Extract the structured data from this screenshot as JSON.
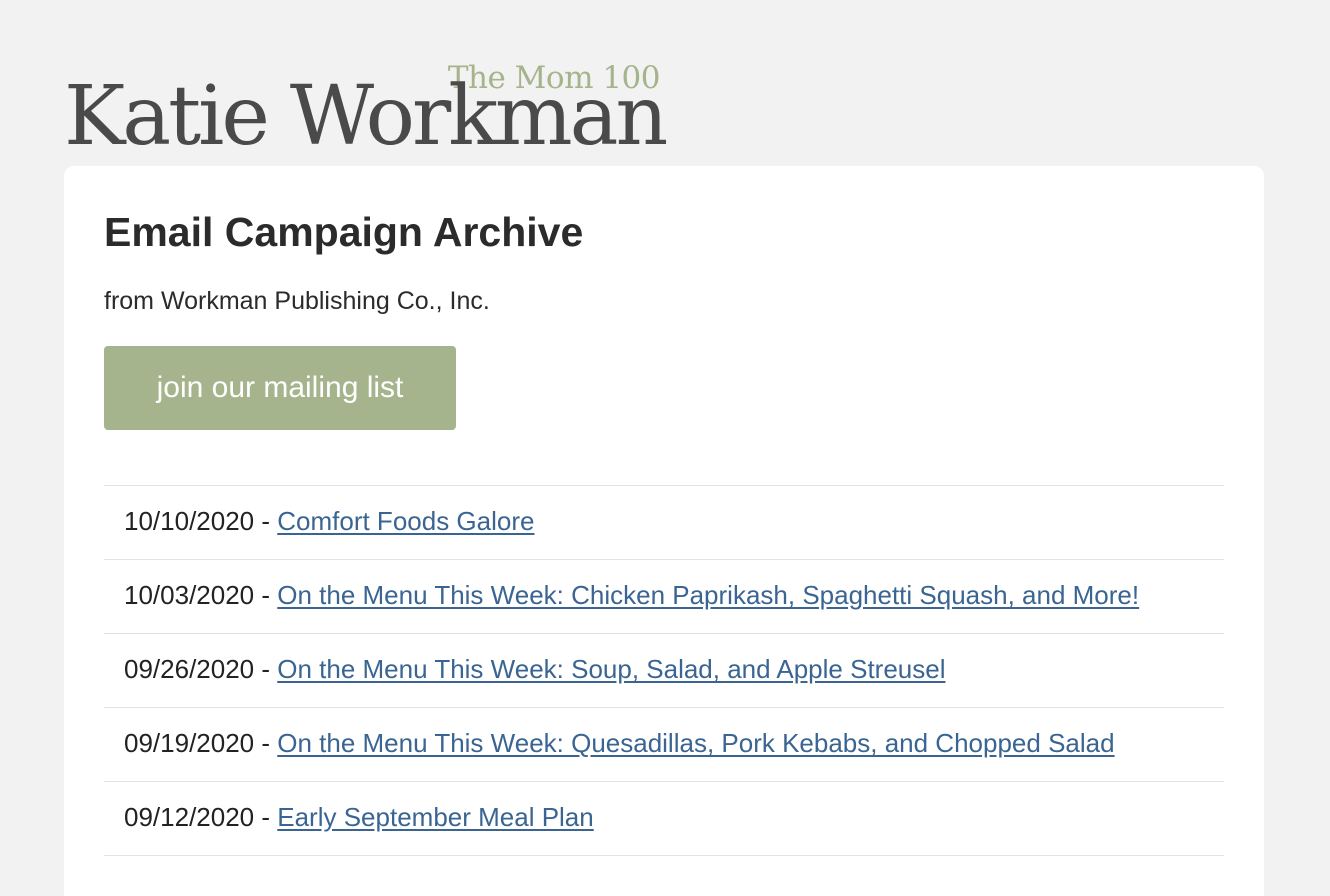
{
  "logo": {
    "tagline": "The Mom 100",
    "name": "Katie Workman"
  },
  "header": {
    "title": "Email Campaign Archive",
    "subtitle": "from Workman Publishing Co., Inc."
  },
  "join_button": {
    "label": "join our mailing list"
  },
  "colors": {
    "background": "#f2f2f2",
    "button": "#a5b48d",
    "link": "#3a6592",
    "tagline": "#a5b48a"
  },
  "campaigns": [
    {
      "date": "10/10/2020",
      "separator": " - ",
      "title": "Comfort Foods Galore"
    },
    {
      "date": "10/03/2020",
      "separator": " - ",
      "title": "On the Menu This Week: Chicken Paprikash, Spaghetti Squash, and More!"
    },
    {
      "date": "09/26/2020",
      "separator": " - ",
      "title": "On the Menu This Week: Soup, Salad, and Apple Streusel"
    },
    {
      "date": "09/19/2020",
      "separator": " - ",
      "title": "On the Menu This Week: Quesadillas, Pork Kebabs, and Chopped Salad"
    },
    {
      "date": "09/12/2020",
      "separator": " - ",
      "title": "Early September Meal Plan"
    }
  ]
}
